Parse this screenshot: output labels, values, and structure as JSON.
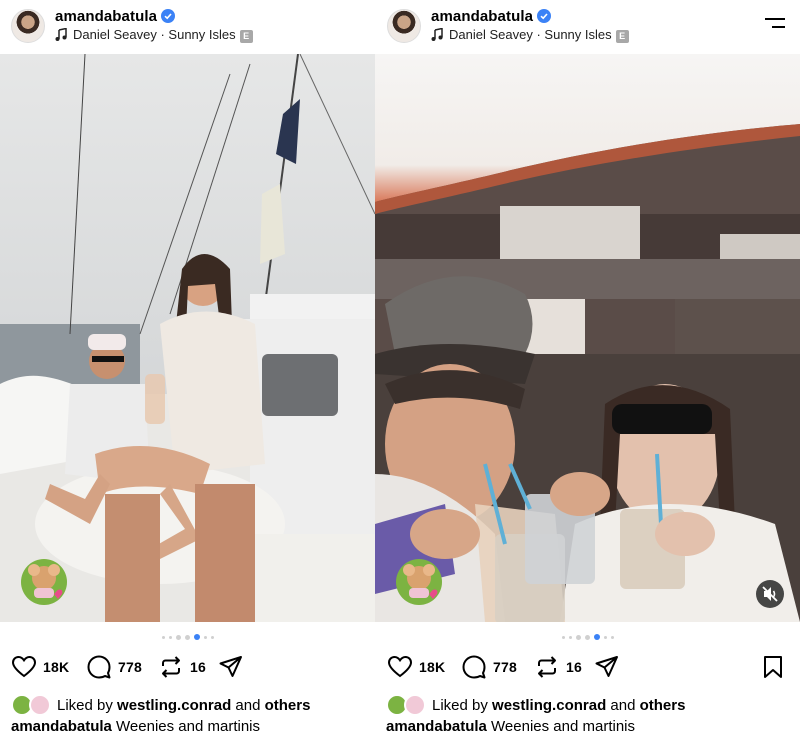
{
  "posts": [
    {
      "username": "amandabatula",
      "music_artist": "Daniel Seavey",
      "music_sep": "·",
      "music_track": "Sunny Isles",
      "explicit_badge": "E",
      "likes": "18K",
      "comments": "778",
      "reposts": "16",
      "liked_by_prefix": "Liked by",
      "liked_by_user": "westling.conrad",
      "liked_by_and": "and",
      "liked_by_suffix": "others",
      "caption_user": "amandabatula",
      "caption_text": "Weenies and martinis",
      "carousel_active_index": 4
    },
    {
      "username": "amandabatula",
      "music_artist": "Daniel Seavey",
      "music_sep": "·",
      "music_track": "Sunny Isles",
      "explicit_badge": "E",
      "likes": "18K",
      "comments": "778",
      "reposts": "16",
      "liked_by_prefix": "Liked by",
      "liked_by_user": "westling.conrad",
      "liked_by_and": "and",
      "liked_by_suffix": "others",
      "caption_user": "amandabatula",
      "caption_text": "Weenies and martinis",
      "carousel_active_index": 4
    }
  ],
  "colors": {
    "verified": "#3b82f6",
    "active_dot": "#3b82f6"
  },
  "icons": [
    "verified-badge-icon",
    "music-note-icon",
    "heart-icon",
    "comment-icon",
    "repost-icon",
    "share-icon",
    "bookmark-icon",
    "menu-icon",
    "mute-icon"
  ]
}
